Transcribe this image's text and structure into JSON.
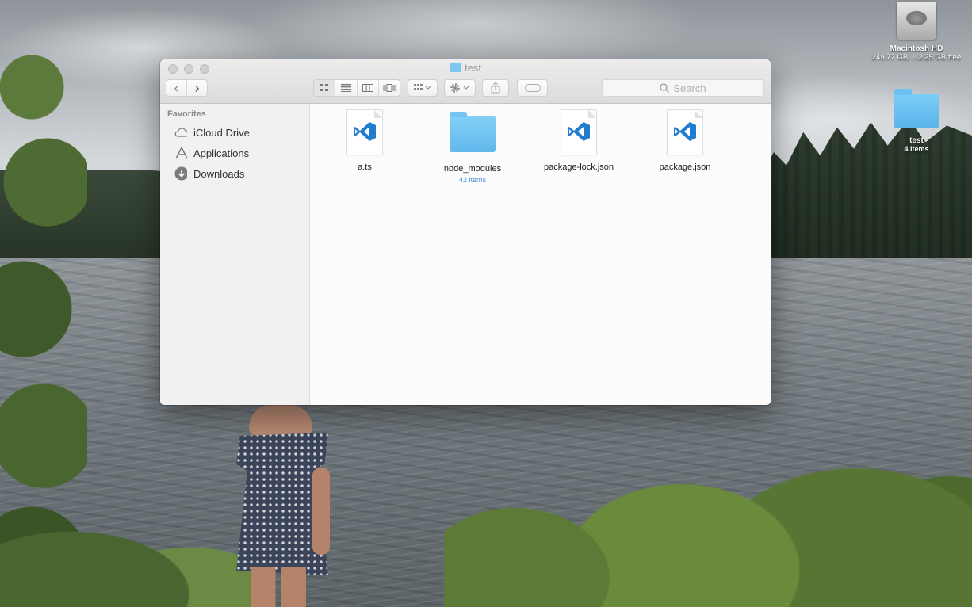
{
  "desktop": {
    "hd": {
      "name": "Macintosh HD",
      "free": "249.77 GB, ...2.25 GB free"
    },
    "folder": {
      "name": "test",
      "count": "4 items"
    }
  },
  "window": {
    "title": "test",
    "toolbar": {
      "search_placeholder": "Search",
      "back_glyph": "‹",
      "forward_glyph": "›"
    },
    "sidebar": {
      "heading": "Favorites",
      "items": [
        {
          "label": "iCloud Drive",
          "icon": "cloud-icon"
        },
        {
          "label": "Applications",
          "icon": "applications-icon"
        },
        {
          "label": "Downloads",
          "icon": "downloads-icon"
        }
      ]
    },
    "files": [
      {
        "name": "a.ts",
        "kind": "vscode-document"
      },
      {
        "name": "node_modules",
        "kind": "folder",
        "sub": "42 items"
      },
      {
        "name": "package-lock.json",
        "kind": "vscode-document"
      },
      {
        "name": "package.json",
        "kind": "vscode-document"
      }
    ]
  },
  "colors": {
    "vscode_blue": "#1f7ccf",
    "folder_blue": "#62b8ec"
  }
}
